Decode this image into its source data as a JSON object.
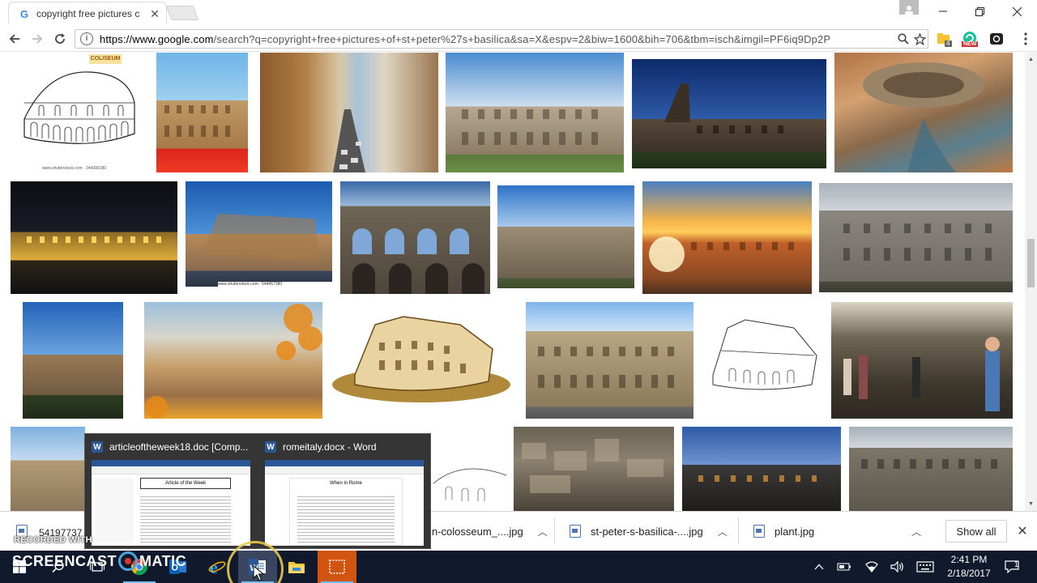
{
  "browser": {
    "tab": {
      "title": "copyright free pictures c",
      "favicon": "google-g-icon"
    },
    "address_bar": {
      "host": "https://www.google.com",
      "path": "/search?q=copyright+free+pictures+of+st+peter%27s+basilica&sa=X&espv=2&biw=1600&bih=706&tbm=isch&imgil=PF6iq9Dp2P"
    },
    "extensions": {
      "count_badge": "4",
      "new_badge": "NEW"
    }
  },
  "image_results": [
    {
      "alt": "Coliseum line drawing",
      "overlay_text": "COLISEUM",
      "caption": "www.shutterstock.com · 344390180"
    },
    {
      "alt": "Colosseum with red flowers"
    },
    {
      "alt": "Street in Rome toward Colosseum"
    },
    {
      "alt": "Colosseum exterior daytime"
    },
    {
      "alt": "Colosseum at dusk"
    },
    {
      "alt": "Aerial view of Colosseum"
    },
    {
      "alt": "Colosseum illuminated at night"
    },
    {
      "alt": "Colosseum blue sky",
      "caption": "www.shutterstock.com · 544457380"
    },
    {
      "alt": "Colosseum arches close-up"
    },
    {
      "alt": "Colosseum with clouds"
    },
    {
      "alt": "Colosseum at sunset"
    },
    {
      "alt": "Colosseum grey sky"
    },
    {
      "alt": "Colosseum side view"
    },
    {
      "alt": "Rome panorama with autumn leaves"
    },
    {
      "alt": "Colosseum cartoon illustration"
    },
    {
      "alt": "Colosseum full facade"
    },
    {
      "alt": "Colosseum sketch"
    },
    {
      "alt": "Tourists inside Colosseum"
    },
    {
      "alt": "Colosseum street view"
    },
    {
      "alt": "Colosseum interior ruins"
    },
    {
      "alt": "Colosseum twilight"
    },
    {
      "alt": "Colosseum facade"
    }
  ],
  "downloads": {
    "items": [
      {
        "name": "54197737",
        "truncated": true
      },
      {
        "name": "n-colosseum_....jpg"
      },
      {
        "name": "st-peter-s-basilica-....jpg"
      },
      {
        "name": "plant.jpg"
      }
    ],
    "show_all": "Show all"
  },
  "taskbar_preview": {
    "windows": [
      {
        "title": "articleoftheweek18.doc [Comp...",
        "doc_heading": "Article of the Week"
      },
      {
        "title": "romeitaly.docx - Word",
        "doc_heading": "When in Rome"
      }
    ]
  },
  "watermark": {
    "recorded_with": "RECORDED WITH",
    "brand_left": "SCREENCAST",
    "brand_right": "MATIC"
  },
  "system_tray": {
    "time": "2:41 PM",
    "date": "2/18/2017",
    "notification_count": "1"
  },
  "colors": {
    "taskbar": "#101a2c",
    "word_blue": "#2b5797",
    "accent": "#76b9ed"
  }
}
